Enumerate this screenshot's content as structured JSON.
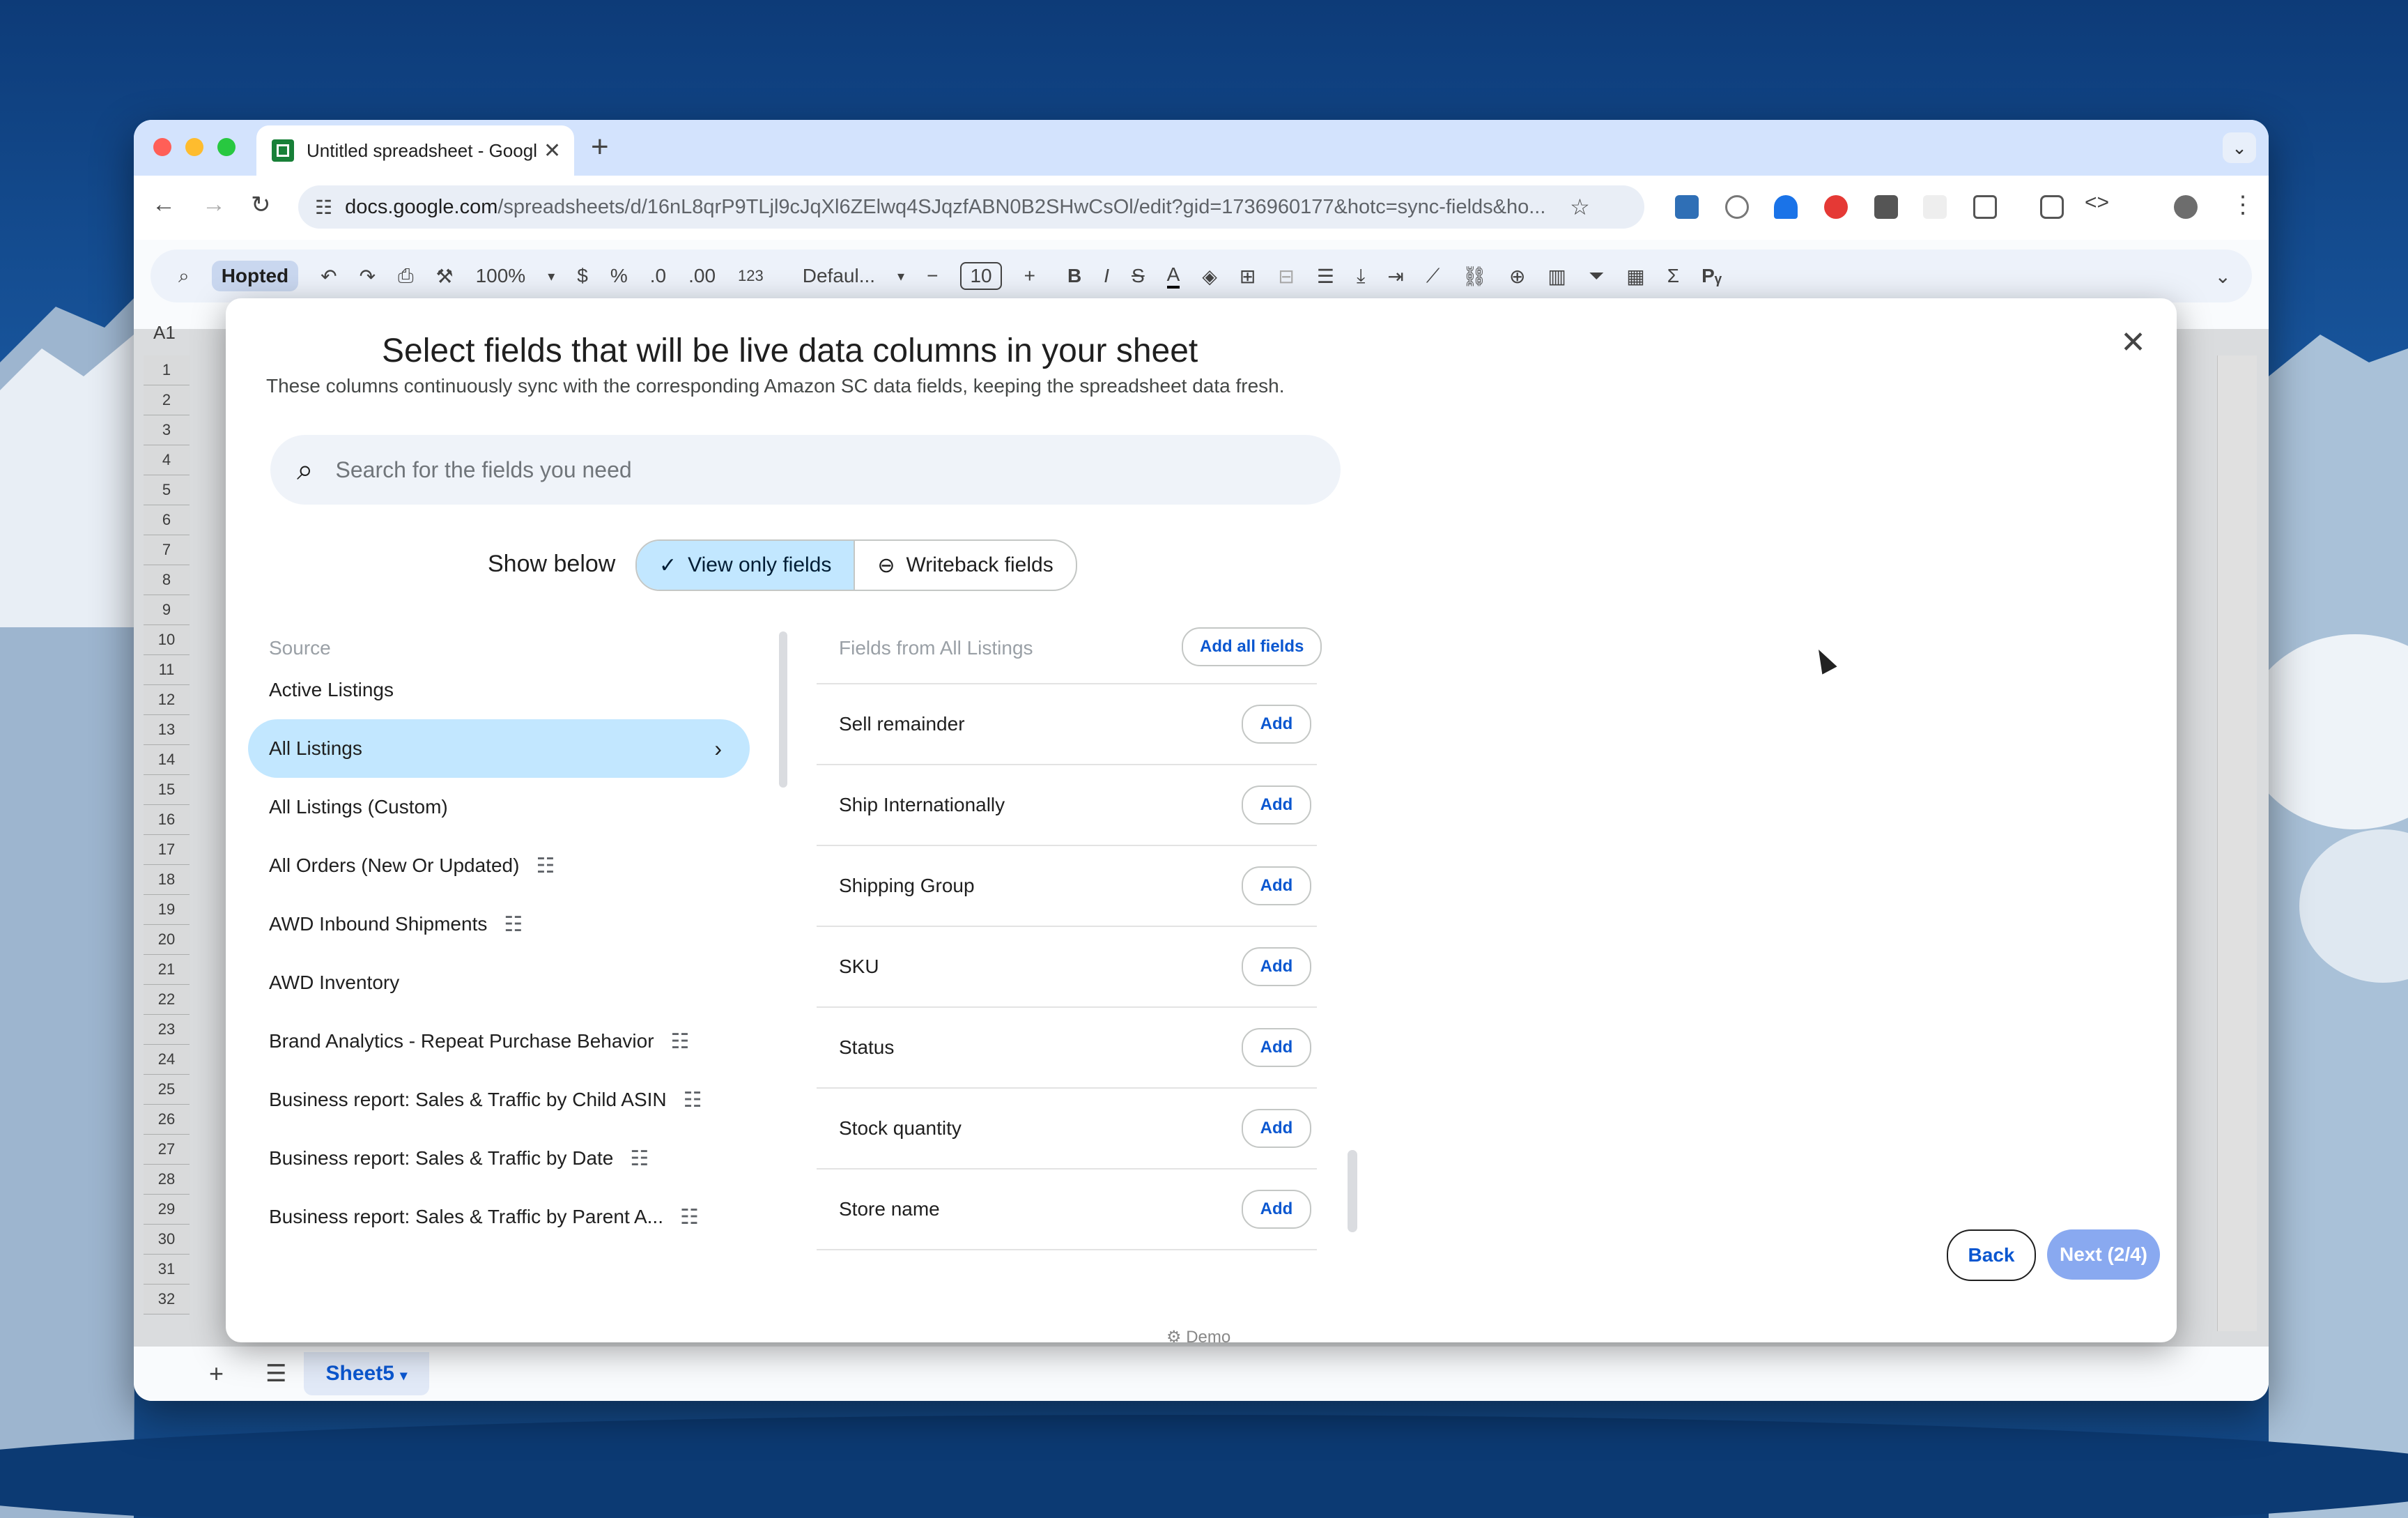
{
  "colors": {
    "accent": "#0b57d0",
    "selected_bg": "#c2e7ff",
    "next_button_bg": "#89a9f0",
    "tabbar_bg": "#d3e3fd"
  },
  "browser": {
    "tab_title": "Untitled spreadsheet - Googl",
    "url_host": "docs.google.com",
    "url_path": "/spreadsheets/d/16nL8qrP9TLjl9cJqXl6ZElwq4SJqzfABN0B2SHwCsOl/edit?gid=1736960177&hotc=sync-fields&ho..."
  },
  "sheets_toolbar": {
    "hopted": "Hopted",
    "zoom": "100%",
    "currency": "$",
    "percent": "%",
    "dec_decrease": ".0",
    "dec_increase": ".00",
    "number_format": "123",
    "font": "Defaul...",
    "font_size": "10",
    "bold": "B",
    "italic": "I",
    "name_box": "A1"
  },
  "row_numbers": [
    "1",
    "2",
    "3",
    "4",
    "5",
    "6",
    "7",
    "8",
    "9",
    "10",
    "11",
    "12",
    "13",
    "14",
    "15",
    "16",
    "17",
    "18",
    "19",
    "20",
    "21",
    "22",
    "23",
    "24",
    "25",
    "26",
    "27",
    "28",
    "29",
    "30",
    "31",
    "32"
  ],
  "sheet_tab": "Sheet5",
  "modal": {
    "title": "Select fields that will be live data columns in your sheet",
    "subtitle": "These columns continuously sync with the corresponding Amazon SC data fields, keeping the spreadsheet data fresh.",
    "search_placeholder": "Search for the fields you need",
    "show_below": "Show below",
    "view_only": "View only fields",
    "writeback": "Writeback fields",
    "source_header": "Source",
    "sources": [
      {
        "label": "Active Listings",
        "tune": false
      },
      {
        "label": "All Listings",
        "tune": false,
        "selected": true
      },
      {
        "label": "All Listings (Custom)",
        "tune": false
      },
      {
        "label": "All Orders (New Or Updated)",
        "tune": true
      },
      {
        "label": "AWD Inbound Shipments",
        "tune": true
      },
      {
        "label": "AWD Inventory",
        "tune": false
      },
      {
        "label": "Brand Analytics - Repeat Purchase Behavior",
        "tune": true
      },
      {
        "label": "Business report: Sales & Traffic by Child ASIN",
        "tune": true
      },
      {
        "label": "Business report: Sales & Traffic by Date",
        "tune": true
      },
      {
        "label": "Business report: Sales & Traffic by Parent A...",
        "tune": true
      }
    ],
    "fields_header": "Fields from All Listings",
    "add_all": "Add all fields",
    "add_label": "Add",
    "fields": [
      "Sell remainder",
      "Ship Internationally",
      "Shipping Group",
      "SKU",
      "Status",
      "Stock quantity",
      "Store name"
    ],
    "back": "Back",
    "next": "Next (2/4)",
    "demo": "Demo"
  }
}
